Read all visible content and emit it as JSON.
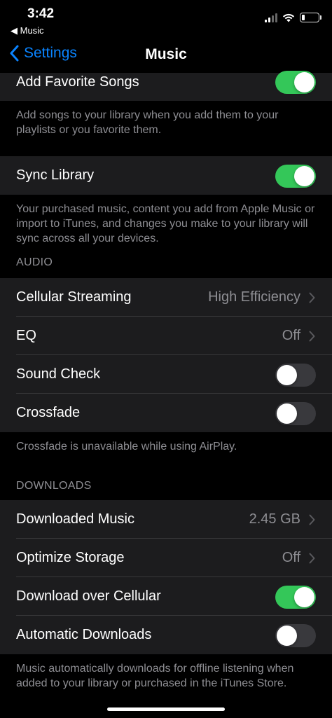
{
  "status_bar": {
    "time": "3:42",
    "back_app": "◀ Music"
  },
  "nav": {
    "back_label": "Settings",
    "title": "Music"
  },
  "sections": {
    "add_favorite": {
      "label": "Add Favorite Songs",
      "footer": "Add songs to your library when you add them to your playlists or you favorite them."
    },
    "sync": {
      "label": "Sync Library",
      "footer": "Your purchased music, content you add from Apple Music or import to iTunes, and changes you make to your library will sync across all your devices."
    },
    "audio": {
      "header": "AUDIO",
      "cellular_streaming": {
        "label": "Cellular Streaming",
        "value": "High Efficiency"
      },
      "eq": {
        "label": "EQ",
        "value": "Off"
      },
      "sound_check": {
        "label": "Sound Check"
      },
      "crossfade": {
        "label": "Crossfade"
      },
      "footer": "Crossfade is unavailable while using AirPlay."
    },
    "downloads": {
      "header": "DOWNLOADS",
      "downloaded_music": {
        "label": "Downloaded Music",
        "value": "2.45 GB"
      },
      "optimize_storage": {
        "label": "Optimize Storage",
        "value": "Off"
      },
      "download_cellular": {
        "label": "Download over Cellular"
      },
      "automatic_downloads": {
        "label": "Automatic Downloads"
      },
      "footer": "Music automatically downloads for offline listening when added to your library or purchased in the iTunes Store."
    }
  },
  "toggles": {
    "add_favorite": true,
    "sync_library": true,
    "sound_check": false,
    "crossfade": false,
    "download_cellular": true,
    "automatic_downloads": false
  },
  "colors": {
    "accent": "#0a84ff",
    "toggle_on": "#34c759",
    "cell_bg": "#1c1c1e"
  },
  "icons": [
    "chevron-left-icon",
    "chevron-right-icon",
    "signal-icon",
    "wifi-icon",
    "battery-icon"
  ]
}
